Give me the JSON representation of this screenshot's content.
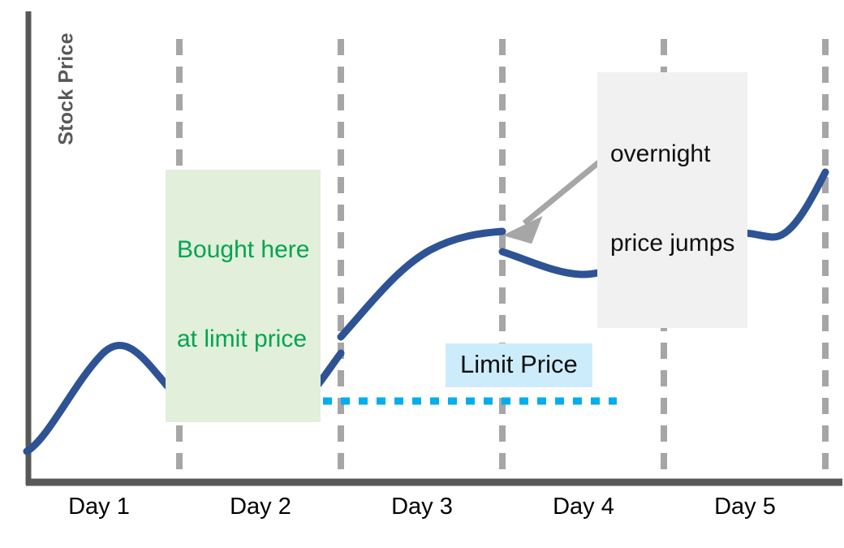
{
  "chart_data": {
    "type": "line",
    "title": "",
    "xlabel": "",
    "ylabel": "Stock Price",
    "categories": [
      "Day 1",
      "Day 2",
      "Day 3",
      "Day 4",
      "Day 5"
    ],
    "grid": "vertical dashed day boundaries",
    "legend": "none",
    "axis_notes": "Y axis unlabeled (no tick values); X axis spans 5 trading days separated by dashed lines",
    "series": [
      {
        "name": "Stock Price",
        "color": "#2E5395",
        "segments": [
          {
            "day": "Day 1",
            "points": [
              [
                0,
                18
              ],
              [
                5,
                28
              ],
              [
                10,
                42
              ],
              [
                14,
                52
              ],
              [
                18,
                57
              ],
              [
                22,
                58
              ],
              [
                26,
                55
              ],
              [
                30,
                49
              ],
              [
                34,
                42
              ],
              [
                38,
                36
              ],
              [
                40,
                33
              ]
            ],
            "description": "rises from open, peaks mid-day, declines into the close at the limit price"
          },
          {
            "day": "Day 2",
            "points": [
              [
                40,
                33
              ],
              [
                44,
                37
              ],
              [
                48,
                38
              ],
              [
                52,
                36
              ],
              [
                56,
                32
              ],
              [
                60,
                29
              ],
              [
                64,
                28
              ],
              [
                68,
                30
              ],
              [
                72,
                35
              ],
              [
                76,
                42
              ],
              [
                80,
                50
              ]
            ],
            "description": "small bump, dips below limit price (fill occurs), then rallies into the close"
          },
          {
            "day": "Day 3",
            "points": [
              [
                80,
                53
              ],
              [
                84,
                62
              ],
              [
                88,
                70
              ],
              [
                92,
                76
              ],
              [
                96,
                80
              ],
              [
                100,
                83
              ],
              [
                104,
                85
              ],
              [
                108,
                86
              ],
              [
                112,
                87
              ],
              [
                116,
                88
              ],
              [
                120,
                88
              ]
            ],
            "description": "strong uptrend flattening into the close"
          },
          {
            "day": "Day 4",
            "points": [
              [
                120,
                84
              ],
              [
                124,
                81
              ],
              [
                128,
                79
              ],
              [
                132,
                77
              ],
              [
                136,
                76
              ],
              [
                140,
                76
              ],
              [
                144,
                77
              ],
              [
                148,
                80
              ],
              [
                152,
                83
              ],
              [
                156,
                86
              ],
              [
                160,
                88
              ]
            ],
            "description": "morning dip then recovery to a higher close"
          },
          {
            "day": "Day 5",
            "points": [
              [
                160,
                85
              ],
              [
                164,
                87
              ],
              [
                168,
                88
              ],
              [
                172,
                89
              ],
              [
                176,
                90
              ],
              [
                180,
                90
              ],
              [
                184,
                90
              ],
              [
                188,
                89
              ],
              [
                192,
                92
              ],
              [
                196,
                98
              ],
              [
                200,
                104
              ]
            ],
            "description": "gradual grind higher, brief pause, then a sharp rally into the close"
          }
        ],
        "gaps": [
          {
            "between": "Day 2 close and Day 3 open",
            "direction": "up"
          },
          {
            "between": "Day 3 close and Day 4 open",
            "direction": "down"
          },
          {
            "between": "Day 4 close and Day 5 open",
            "direction": "down"
          }
        ]
      }
    ],
    "reference_lines": [
      {
        "name": "limit-price-line",
        "label": "Limit Price",
        "orientation": "horizontal",
        "style": "dotted",
        "color": "#00AEEF",
        "starts_at": "Day 1/Day 2 boundary",
        "ends_at": "mid Day 4"
      }
    ],
    "annotations": [
      {
        "name": "bought-here-annotation",
        "text": "Bought here\nat limit price",
        "color": "#00A550",
        "background": "#E2EFDA",
        "arrow": {
          "style": "thick down arrow",
          "color": "#00A550",
          "points_to": "Day 2 trough at the limit price"
        }
      },
      {
        "name": "overnight-price-jumps-annotation",
        "text": "overnight\nprice jumps",
        "color": "#101010",
        "background": "#F1F1F1",
        "arrows": [
          {
            "color": "#A6A6A6",
            "points_to": "gap at Day 3/Day 4 boundary"
          },
          {
            "color": "#A6A6A6",
            "points_to": "gap at Day 4/Day 5 boundary"
          }
        ]
      },
      {
        "name": "limit-price-label",
        "text": "Limit Price",
        "color": "#101010",
        "background": "#CCECFB"
      }
    ]
  },
  "axes": {
    "y_title": "Stock Price",
    "x_labels": [
      "Day 1",
      "Day 2",
      "Day 3",
      "Day 4",
      "Day 5"
    ]
  },
  "annotations": {
    "bought": {
      "line1": "Bought here",
      "line2": "at limit price"
    },
    "overnight": {
      "line1": "overnight",
      "line2": "price jumps"
    },
    "limit_price": "Limit Price"
  },
  "colors": {
    "price_line": "#2E5395",
    "limit_line": "#00AEEF",
    "buy_arrow": "#00A550",
    "buy_box_bg": "#E2EFDA",
    "overnight_box_bg": "#F1F1F1",
    "limit_box_bg": "#CCECFB",
    "gridline": "#A6A6A6",
    "axis": "#585858"
  }
}
